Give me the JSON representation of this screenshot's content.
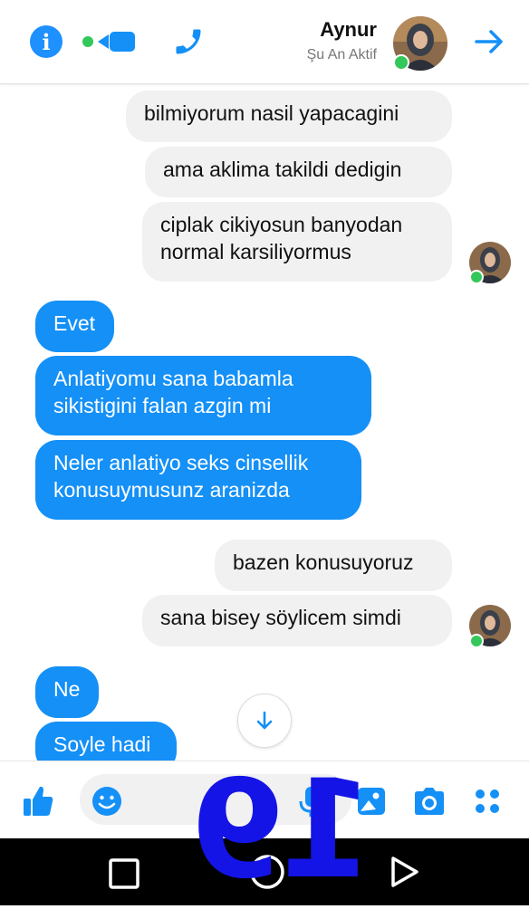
{
  "header": {
    "contact_name": "Aynur",
    "contact_status": "Şu An Aktif",
    "icons": [
      "info-icon",
      "video-call-icon",
      "phone-icon",
      "forward-arrow-icon"
    ]
  },
  "messages": [
    {
      "side": "received",
      "text": "bilmiyorum nasil yapacagini"
    },
    {
      "side": "received",
      "text": "ama aklima takildi dedigin"
    },
    {
      "side": "received",
      "text_lines": [
        "ciplak cikiyosun banyodan",
        "normal karsiliyormus"
      ]
    },
    {
      "side": "sent",
      "text": "Evet"
    },
    {
      "side": "sent",
      "text_lines": [
        "Anlatiyomu sana babamla",
        "sikistigini falan azgin mi"
      ]
    },
    {
      "side": "sent",
      "text_lines": [
        "Neler anlatiyo seks cinsellik",
        "konusuymusunz aranizda"
      ]
    },
    {
      "side": "received",
      "text": "bazen konusuyoruz"
    },
    {
      "side": "received",
      "text": "sana bisey söylicem simdi"
    },
    {
      "side": "sent",
      "text": "Ne"
    },
    {
      "side": "sent",
      "text": "Soyle hadi"
    }
  ],
  "composer": {
    "icons": [
      "like-icon",
      "emoji-icon",
      "mic-icon",
      "gallery-icon",
      "camera-icon",
      "apps-icon"
    ]
  },
  "watermark": "19",
  "colors": {
    "accent": "#1490f7",
    "received_bubble": "#f1f1f1",
    "online": "#34c759",
    "watermark": "#1414e6"
  }
}
